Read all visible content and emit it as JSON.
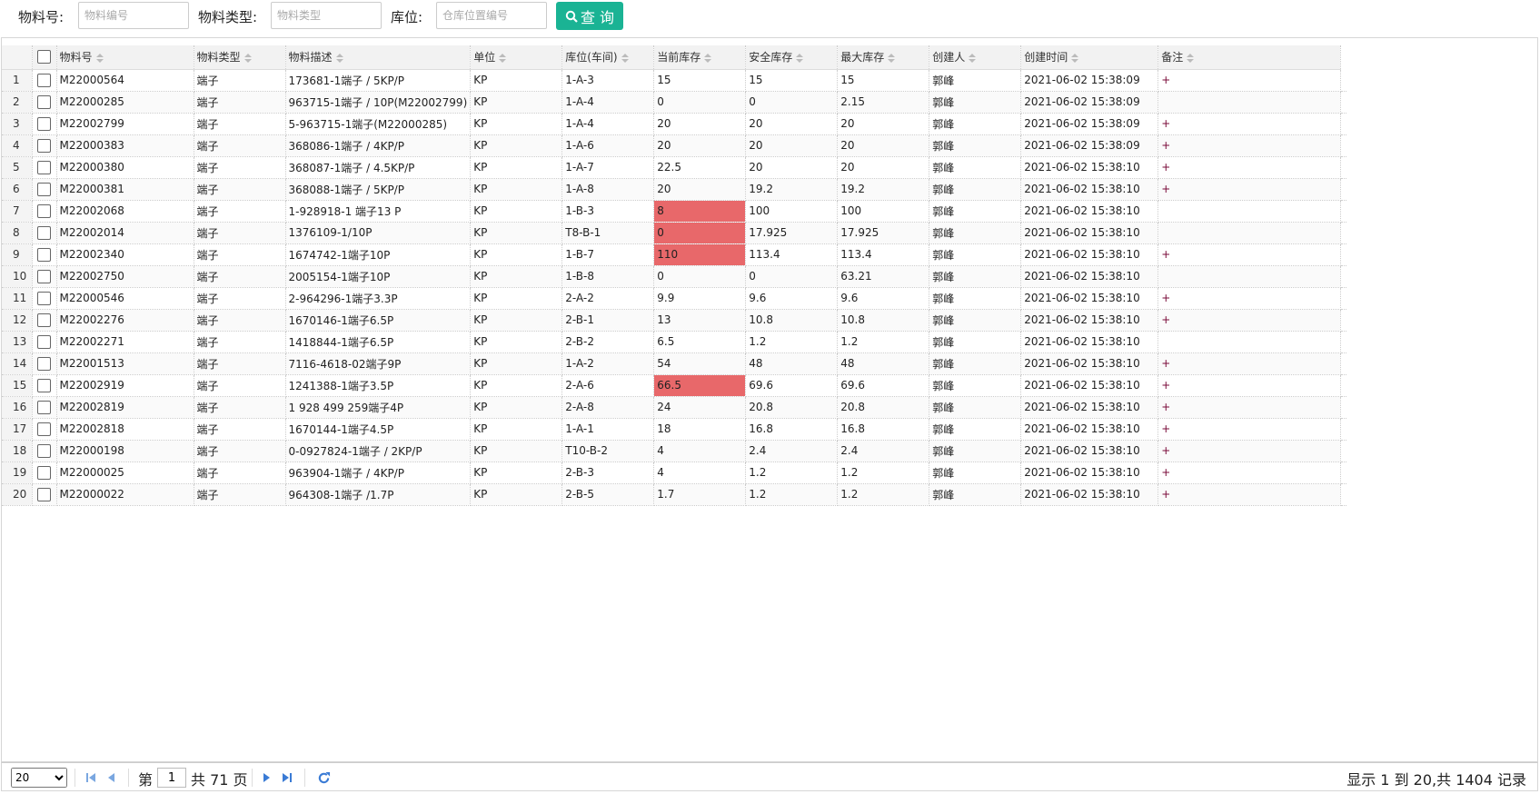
{
  "toolbar": {
    "material_no_label": "物料号:",
    "material_no_placeholder": "物料编号",
    "material_type_label": "物料类型:",
    "material_type_placeholder": "物料类型",
    "location_label": "库位:",
    "location_placeholder": "仓库位置编号",
    "query_label": "查 询",
    "query_icon": "search-icon"
  },
  "columns": [
    "物料号",
    "物料类型",
    "物料描述",
    "单位",
    "库位(车间)",
    "当前库存",
    "安全库存",
    "最大库存",
    "创建人",
    "创建时间",
    "备注"
  ],
  "rows": [
    {
      "n": "1",
      "code": "M22000564",
      "type": "端子",
      "desc": "173681-1端子 / 5KP/P",
      "unit": "KP",
      "loc": "1-A-3",
      "cur": "15",
      "safe": "15",
      "max": "15",
      "creator": "郭峰",
      "time": "2021-06-02 15:38:09",
      "note": "+",
      "warn": false
    },
    {
      "n": "2",
      "code": "M22000285",
      "type": "端子",
      "desc": "963715-1端子 / 10P(M22002799)",
      "unit": "KP",
      "loc": "1-A-4",
      "cur": "0",
      "safe": "0",
      "max": "2.15",
      "creator": "郭峰",
      "time": "2021-06-02 15:38:09",
      "note": "",
      "warn": false
    },
    {
      "n": "3",
      "code": "M22002799",
      "type": "端子",
      "desc": "5-963715-1端子(M22000285)",
      "unit": "KP",
      "loc": "1-A-4",
      "cur": "20",
      "safe": "20",
      "max": "20",
      "creator": "郭峰",
      "time": "2021-06-02 15:38:09",
      "note": "+",
      "warn": false
    },
    {
      "n": "4",
      "code": "M22000383",
      "type": "端子",
      "desc": "368086-1端子 / 4KP/P",
      "unit": "KP",
      "loc": "1-A-6",
      "cur": "20",
      "safe": "20",
      "max": "20",
      "creator": "郭峰",
      "time": "2021-06-02 15:38:09",
      "note": "+",
      "warn": false
    },
    {
      "n": "5",
      "code": "M22000380",
      "type": "端子",
      "desc": "368087-1端子 / 4.5KP/P",
      "unit": "KP",
      "loc": "1-A-7",
      "cur": "22.5",
      "safe": "20",
      "max": "20",
      "creator": "郭峰",
      "time": "2021-06-02 15:38:10",
      "note": "+",
      "warn": false
    },
    {
      "n": "6",
      "code": "M22000381",
      "type": "端子",
      "desc": "368088-1端子 / 5KP/P",
      "unit": "KP",
      "loc": "1-A-8",
      "cur": "20",
      "safe": "19.2",
      "max": "19.2",
      "creator": "郭峰",
      "time": "2021-06-02 15:38:10",
      "note": "+",
      "warn": false
    },
    {
      "n": "7",
      "code": "M22002068",
      "type": "端子",
      "desc": "1-928918-1 端子13 P",
      "unit": "KP",
      "loc": "1-B-3",
      "cur": "8",
      "safe": "100",
      "max": "100",
      "creator": "郭峰",
      "time": "2021-06-02 15:38:10",
      "note": "",
      "warn": true
    },
    {
      "n": "8",
      "code": "M22002014",
      "type": "端子",
      "desc": "1376109-1/10P",
      "unit": "KP",
      "loc": "T8-B-1",
      "cur": "0",
      "safe": "17.925",
      "max": "17.925",
      "creator": "郭峰",
      "time": "2021-06-02 15:38:10",
      "note": "",
      "warn": true
    },
    {
      "n": "9",
      "code": "M22002340",
      "type": "端子",
      "desc": "1674742-1端子10P",
      "unit": "KP",
      "loc": "1-B-7",
      "cur": "110",
      "safe": "113.4",
      "max": "113.4",
      "creator": "郭峰",
      "time": "2021-06-02 15:38:10",
      "note": "+",
      "warn": true
    },
    {
      "n": "10",
      "code": "M22002750",
      "type": "端子",
      "desc": "2005154-1端子10P",
      "unit": "KP",
      "loc": "1-B-8",
      "cur": "0",
      "safe": "0",
      "max": "63.21",
      "creator": "郭峰",
      "time": "2021-06-02 15:38:10",
      "note": "",
      "warn": false
    },
    {
      "n": "11",
      "code": "M22000546",
      "type": "端子",
      "desc": "2-964296-1端子3.3P",
      "unit": "KP",
      "loc": "2-A-2",
      "cur": "9.9",
      "safe": "9.6",
      "max": "9.6",
      "creator": "郭峰",
      "time": "2021-06-02 15:38:10",
      "note": "+",
      "warn": false
    },
    {
      "n": "12",
      "code": "M22002276",
      "type": "端子",
      "desc": "1670146-1端子6.5P",
      "unit": "KP",
      "loc": "2-B-1",
      "cur": "13",
      "safe": "10.8",
      "max": "10.8",
      "creator": "郭峰",
      "time": "2021-06-02 15:38:10",
      "note": "+",
      "warn": false
    },
    {
      "n": "13",
      "code": "M22002271",
      "type": "端子",
      "desc": "1418844-1端子6.5P",
      "unit": "KP",
      "loc": "2-B-2",
      "cur": "6.5",
      "safe": "1.2",
      "max": "1.2",
      "creator": "郭峰",
      "time": "2021-06-02 15:38:10",
      "note": "",
      "warn": false
    },
    {
      "n": "14",
      "code": "M22001513",
      "type": "端子",
      "desc": "7116-4618-02端子9P",
      "unit": "KP",
      "loc": "1-A-2",
      "cur": "54",
      "safe": "48",
      "max": "48",
      "creator": "郭峰",
      "time": "2021-06-02 15:38:10",
      "note": "+",
      "warn": false
    },
    {
      "n": "15",
      "code": "M22002919",
      "type": "端子",
      "desc": "1241388-1端子3.5P",
      "unit": "KP",
      "loc": "2-A-6",
      "cur": "66.5",
      "safe": "69.6",
      "max": "69.6",
      "creator": "郭峰",
      "time": "2021-06-02 15:38:10",
      "note": "+",
      "warn": true
    },
    {
      "n": "16",
      "code": "M22002819",
      "type": "端子",
      "desc": "1 928 499 259端子4P",
      "unit": "KP",
      "loc": "2-A-8",
      "cur": "24",
      "safe": "20.8",
      "max": "20.8",
      "creator": "郭峰",
      "time": "2021-06-02 15:38:10",
      "note": "+",
      "warn": false
    },
    {
      "n": "17",
      "code": "M22002818",
      "type": "端子",
      "desc": "1670144-1端子4.5P",
      "unit": "KP",
      "loc": "1-A-1",
      "cur": "18",
      "safe": "16.8",
      "max": "16.8",
      "creator": "郭峰",
      "time": "2021-06-02 15:38:10",
      "note": "+",
      "warn": false
    },
    {
      "n": "18",
      "code": "M22000198",
      "type": "端子",
      "desc": "0-0927824-1端子 / 2KP/P",
      "unit": "KP",
      "loc": "T10-B-2",
      "cur": "4",
      "safe": "2.4",
      "max": "2.4",
      "creator": "郭峰",
      "time": "2021-06-02 15:38:10",
      "note": "+",
      "warn": false
    },
    {
      "n": "19",
      "code": "M22000025",
      "type": "端子",
      "desc": "963904-1端子 / 4KP/P",
      "unit": "KP",
      "loc": "2-B-3",
      "cur": "4",
      "safe": "1.2",
      "max": "1.2",
      "creator": "郭峰",
      "time": "2021-06-02 15:38:10",
      "note": "+",
      "warn": false
    },
    {
      "n": "20",
      "code": "M22000022",
      "type": "端子",
      "desc": "964308-1端子 /1.7P",
      "unit": "KP",
      "loc": "2-B-5",
      "cur": "1.7",
      "safe": "1.2",
      "max": "1.2",
      "creator": "郭峰",
      "time": "2021-06-02 15:38:10",
      "note": "+",
      "warn": false
    }
  ],
  "pager": {
    "page_size": "20",
    "page_prefix": "第",
    "page_value": "1",
    "page_suffix": "共 71 页",
    "info": "显示 1 到 20,共 1404 记录"
  },
  "colors": {
    "accent": "#1ab394",
    "warn": "#e8686a"
  }
}
